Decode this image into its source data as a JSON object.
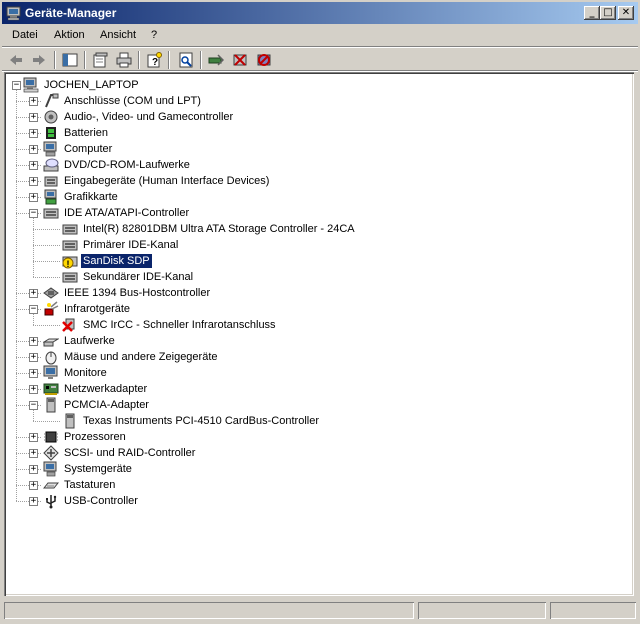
{
  "window": {
    "title": "Geräte-Manager"
  },
  "caption_buttons": {
    "minimize": "_",
    "maximize": "□",
    "close": "✕"
  },
  "menu": {
    "items": [
      "Datei",
      "Aktion",
      "Ansicht",
      "?"
    ]
  },
  "toolbar": {
    "buttons": [
      "back-icon",
      "forward-icon",
      "show-hide-tree-icon",
      "properties-icon",
      "print-icon",
      "help-icon",
      "scan-hardware-icon",
      "update-driver-icon",
      "disable-device-icon",
      "uninstall-device-icon"
    ]
  },
  "tree": {
    "root": "JOCHEN_LAPTOP",
    "categories": [
      {
        "label": "Anschlüsse (COM und LPT)",
        "expanded": false,
        "icon": "port-icon"
      },
      {
        "label": "Audio-, Video- und Gamecontroller",
        "expanded": false,
        "icon": "audio-icon"
      },
      {
        "label": "Batterien",
        "expanded": false,
        "icon": "battery-icon"
      },
      {
        "label": "Computer",
        "expanded": false,
        "icon": "computer-icon"
      },
      {
        "label": "DVD/CD-ROM-Laufwerke",
        "expanded": false,
        "icon": "cdrom-icon"
      },
      {
        "label": "Eingabegeräte (Human Interface Devices)",
        "expanded": false,
        "icon": "hid-icon"
      },
      {
        "label": "Grafikkarte",
        "expanded": false,
        "icon": "display-adapter-icon"
      },
      {
        "label": "IDE ATA/ATAPI-Controller",
        "expanded": true,
        "icon": "ide-controller-icon",
        "children": [
          {
            "label": "Intel(R) 82801DBM Ultra ATA Storage Controller - 24CA",
            "icon": "ide-controller-icon"
          },
          {
            "label": "Primärer IDE-Kanal",
            "icon": "ide-controller-icon"
          },
          {
            "label": "SanDisk SDP",
            "icon": "warning-device-icon",
            "selected": true
          },
          {
            "label": "Sekundärer IDE-Kanal",
            "icon": "ide-controller-icon"
          }
        ]
      },
      {
        "label": "IEEE 1394 Bus-Hostcontroller",
        "expanded": false,
        "icon": "firewire-icon"
      },
      {
        "label": "Infrarotgeräte",
        "expanded": true,
        "icon": "infrared-icon",
        "children": [
          {
            "label": "SMC IrCC - Schneller Infrarotanschluss",
            "icon": "disabled-infrared-icon"
          }
        ]
      },
      {
        "label": "Laufwerke",
        "expanded": false,
        "icon": "disk-drive-icon"
      },
      {
        "label": "Mäuse und andere Zeigegeräte",
        "expanded": false,
        "icon": "mouse-icon"
      },
      {
        "label": "Monitore",
        "expanded": false,
        "icon": "monitor-icon"
      },
      {
        "label": "Netzwerkadapter",
        "expanded": false,
        "icon": "network-adapter-icon"
      },
      {
        "label": "PCMCIA-Adapter",
        "expanded": true,
        "icon": "pcmcia-icon",
        "children": [
          {
            "label": "Texas Instruments PCI-4510 CardBus-Controller",
            "icon": "pcmcia-icon"
          }
        ]
      },
      {
        "label": "Prozessoren",
        "expanded": false,
        "icon": "processor-icon"
      },
      {
        "label": "SCSI- und RAID-Controller",
        "expanded": false,
        "icon": "scsi-icon"
      },
      {
        "label": "Systemgeräte",
        "expanded": false,
        "icon": "system-device-icon"
      },
      {
        "label": "Tastaturen",
        "expanded": false,
        "icon": "keyboard-icon"
      },
      {
        "label": "USB-Controller",
        "expanded": false,
        "icon": "usb-icon"
      }
    ]
  },
  "colors": {
    "title_start": "#0a246a",
    "title_end": "#a6caf0",
    "selection": "#0a246a",
    "face": "#d4d0c8"
  }
}
